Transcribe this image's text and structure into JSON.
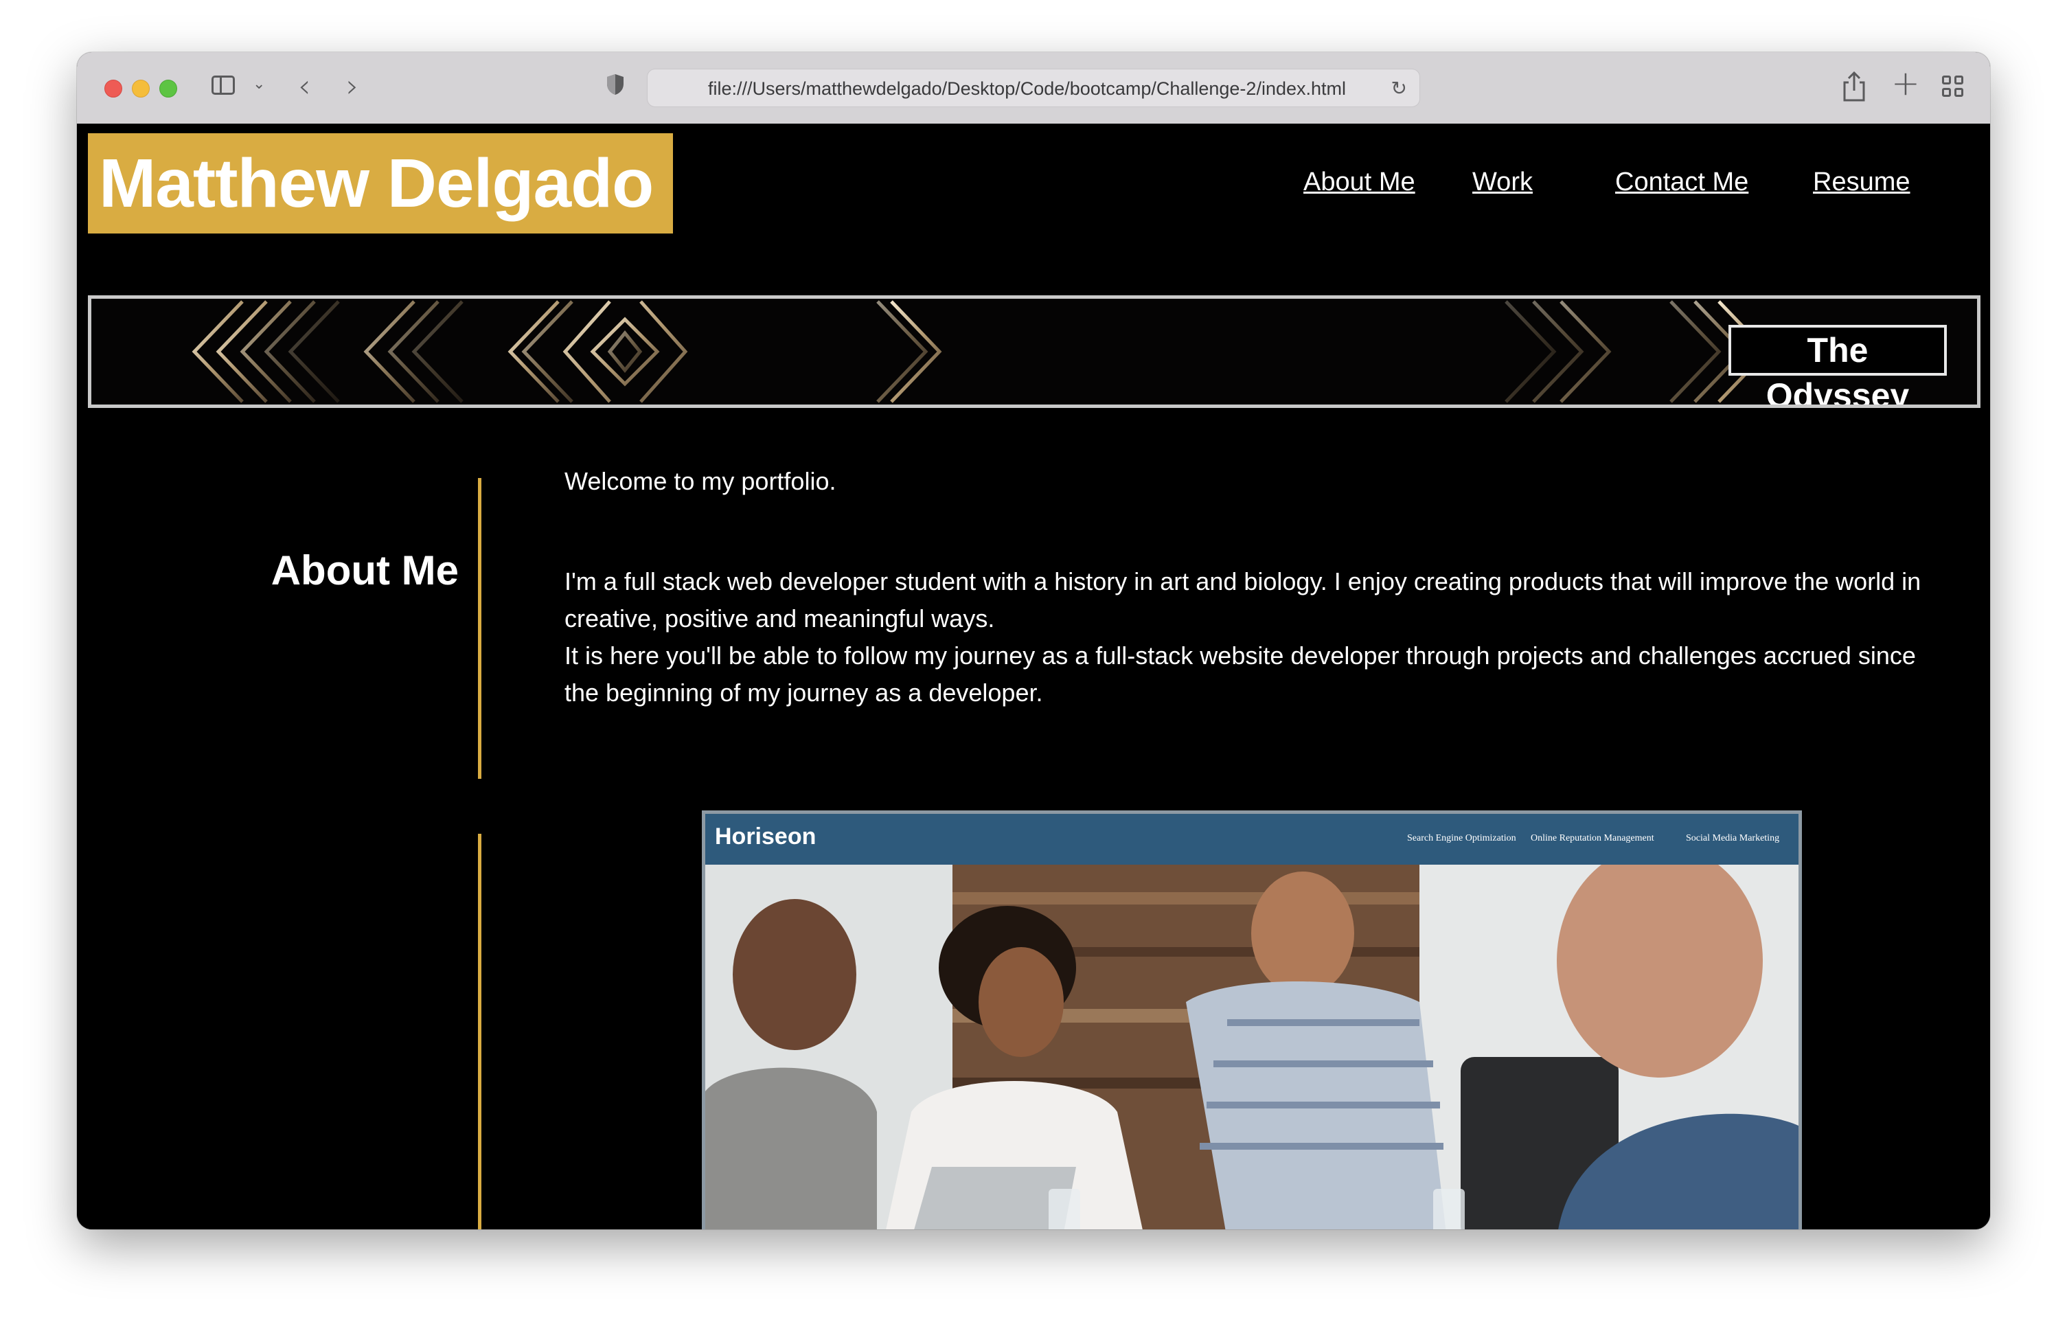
{
  "browser": {
    "url": "file:///Users/matthewdelgado/Desktop/Code/bootcamp/Challenge-2/index.html",
    "icons": [
      "sidebar-toggle-icon",
      "chevron-down-icon",
      "back-arrow-icon",
      "forward-arrow-icon",
      "shield-icon",
      "reload-icon",
      "share-icon",
      "new-tab-plus-icon",
      "tab-overview-icon"
    ]
  },
  "site": {
    "name": "Matthew Delgado",
    "nav": [
      "About Me",
      "Work",
      "Contact Me",
      "Resume"
    ],
    "hero_title": "The Odyssey",
    "accent_color": "#d9ac42"
  },
  "about": {
    "heading": "About Me",
    "welcome": "Welcome to my portfolio.",
    "paragraph1": "I'm a full stack web developer student with a history in art and biology. I enjoy creating products that will improve the world in creative, positive and meaningful ways.",
    "paragraph2": "It is here you'll be able to follow my journey as a full-stack website developer through projects and challenges accrued since the beginning of my journey as a developer."
  },
  "work": {
    "project_logo": "Horiseon",
    "project_nav": [
      "Search Engine Optimization",
      "Online Reputation Management",
      "Social Media Marketing"
    ]
  }
}
